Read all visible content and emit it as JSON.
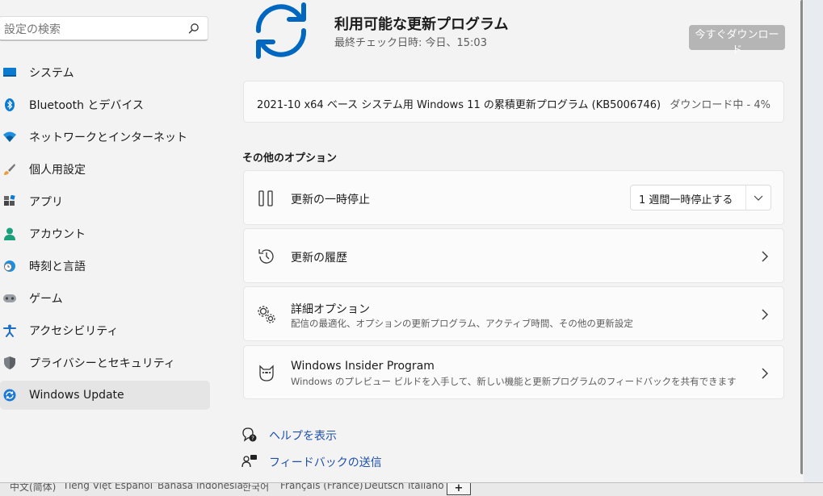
{
  "search": {
    "placeholder": "設定の検索"
  },
  "nav": [
    {
      "label": "システム",
      "icon": "monitor-icon"
    },
    {
      "label": "Bluetooth とデバイス",
      "icon": "bluetooth-icon"
    },
    {
      "label": "ネットワークとインターネット",
      "icon": "wifi-icon"
    },
    {
      "label": "個人用設定",
      "icon": "paintbrush-icon"
    },
    {
      "label": "アプリ",
      "icon": "apps-icon"
    },
    {
      "label": "アカウント",
      "icon": "person-icon"
    },
    {
      "label": "時刻と言語",
      "icon": "globe-clock-icon"
    },
    {
      "label": "ゲーム",
      "icon": "gamepad-icon"
    },
    {
      "label": "アクセシビリティ",
      "icon": "accessibility-icon"
    },
    {
      "label": "プライバシーとセキュリティ",
      "icon": "shield-icon"
    },
    {
      "label": "Windows Update",
      "icon": "windows-update-icon",
      "active": true
    }
  ],
  "header": {
    "title": "利用可能な更新プログラム",
    "subtitle": "最終チェック日時: 今日、15:03",
    "download_button": "今すぐダウンロード"
  },
  "update": {
    "name": "2021-10 x64 ベース システム用 Windows 11 の累積更新プログラム (KB5006746)",
    "status": "ダウンロード中 - 4%"
  },
  "options": {
    "section_title": "その他のオプション",
    "pause": {
      "title": "更新の一時停止",
      "select_value": "1 週間一時停止する"
    },
    "history": {
      "title": "更新の履歴"
    },
    "advanced": {
      "title": "詳細オプション",
      "desc": "配信の最適化、オプションの更新プログラム、アクティブ時間、その他の更新設定"
    },
    "insider": {
      "title": "Windows Insider Program",
      "desc": "Windows のプレビュー ビルドを入手して、新しい機能と更新プログラムのフィードバックを共有できます"
    }
  },
  "links": {
    "help": "ヘルプを表示",
    "feedback": "フィードバックの送信"
  },
  "languages": [
    "中文(简体)",
    "Tiếng Việt",
    "Español",
    "Bahasa Indonesia",
    "한국어",
    "Français (France)",
    "Deutsch",
    "Italiano"
  ],
  "colors": {
    "accent": "#0067c0",
    "link": "#1f4fa8",
    "button_disabled": "#b5b5b5"
  }
}
